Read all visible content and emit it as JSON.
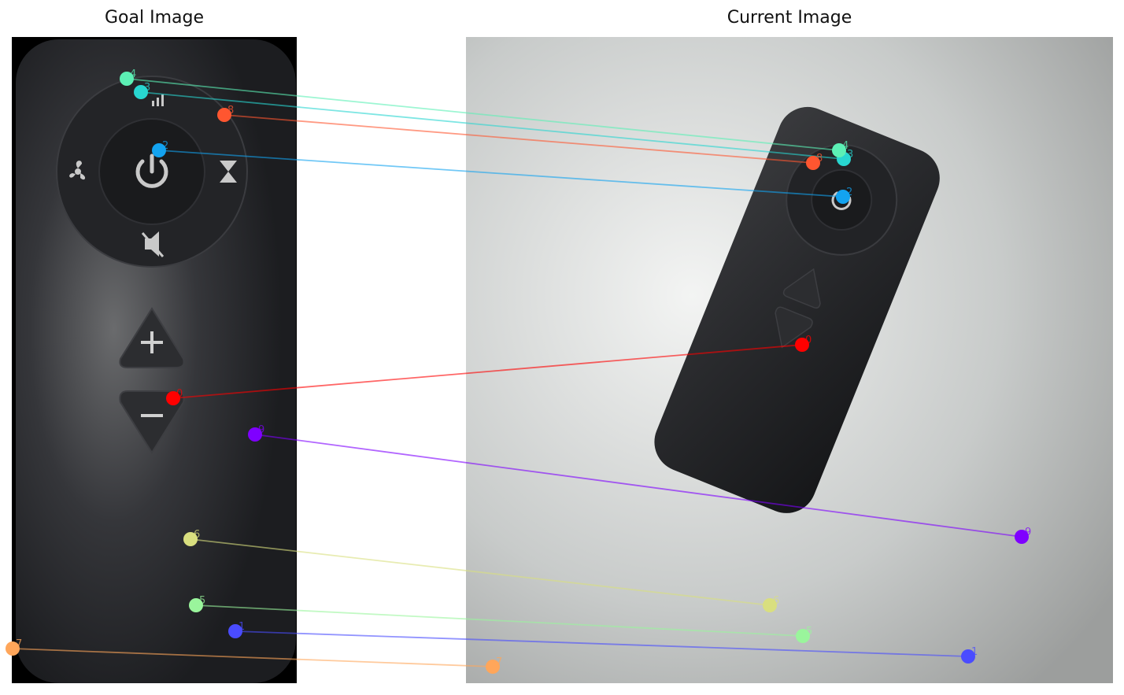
{
  "titles": {
    "goal": "Goal Image",
    "current": "Current Image"
  },
  "colors": {
    "background": "#ffffff",
    "goal_panel_bg": "#000000",
    "remote_body": "#2b2c2e",
    "remote_dark": "#1b1c1e",
    "current_panel_bg": "#c9cccc",
    "icon": "#d8d8d8"
  },
  "matches": [
    {
      "id": "0",
      "color": "#ff0000"
    },
    {
      "id": "1",
      "color": "#4a4cff"
    },
    {
      "id": "2",
      "color": "#13a3f0"
    },
    {
      "id": "3",
      "color": "#28d6d0"
    },
    {
      "id": "4",
      "color": "#5cf0b5"
    },
    {
      "id": "5",
      "color": "#9af59c"
    },
    {
      "id": "6",
      "color": "#d9df7f"
    },
    {
      "id": "7",
      "color": "#ffa65a"
    },
    {
      "id": "8",
      "color": "#ff5630"
    },
    {
      "id": "9",
      "color": "#7f00ff"
    }
  ]
}
